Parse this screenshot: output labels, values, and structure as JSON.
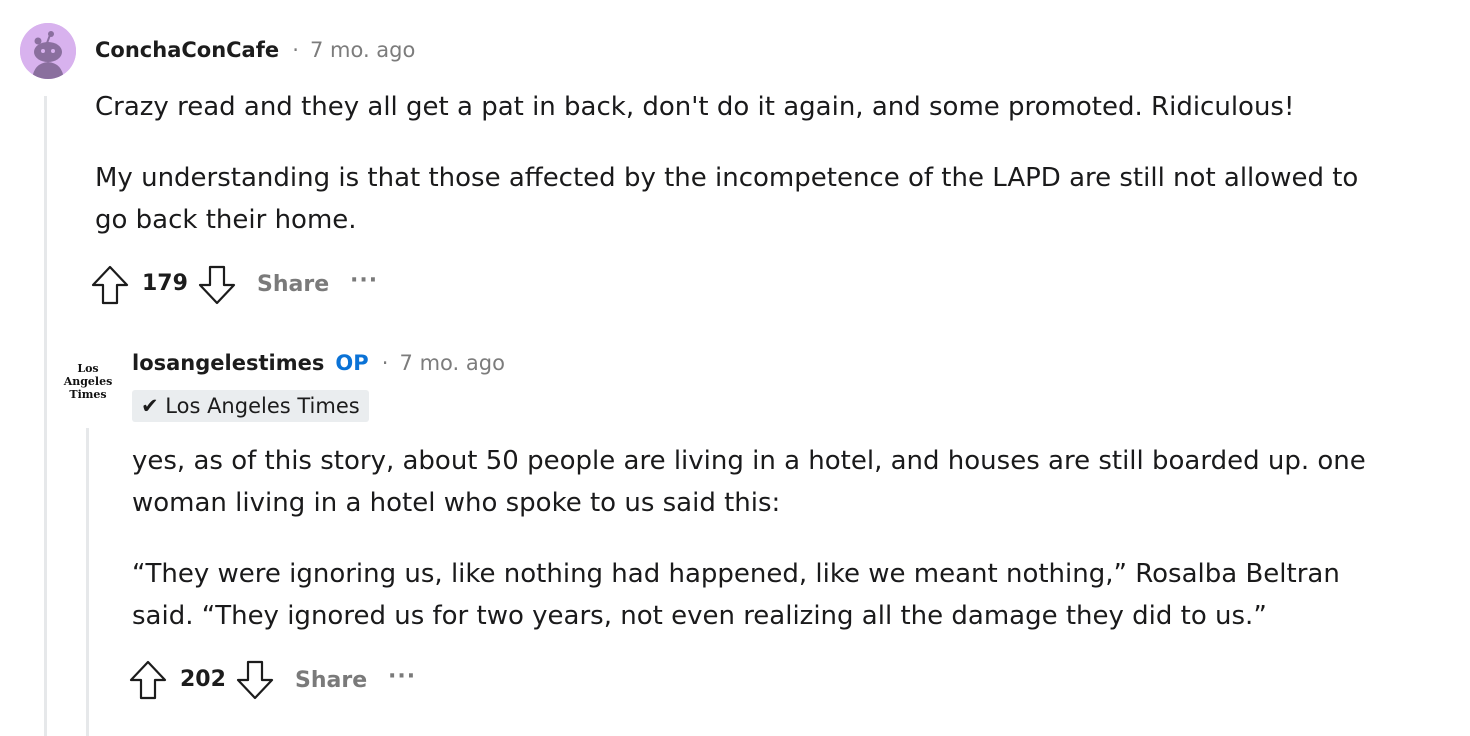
{
  "comments": [
    {
      "author": "ConchaConCafe",
      "separator": "·",
      "time": "7 mo. ago",
      "paragraphs": [
        "Crazy read and they all get a pat in back, don't do it again, and some promoted. Ridiculous!",
        "My understanding is that those affected by the incompetence of the LAPD are still not allowed to go back their home."
      ],
      "votes": "179",
      "share_label": "Share",
      "more_label": "···",
      "avatar_icon": "snoo-avatar-icon"
    },
    {
      "author": "losangelestimes",
      "op_label": "OP",
      "separator": "·",
      "time": "7 mo. ago",
      "flair": "✔ Los Angeles Times",
      "logo_lines": [
        "Los",
        "Angeles",
        "Times"
      ],
      "paragraphs": [
        "yes, as of this story, about 50 people are living in a hotel, and houses are still boarded up. one woman living in a hotel who spoke to us said this:",
        "“They were ignoring us, like nothing had happened, like we meant nothing,” Rosalba Beltran said. “They ignored us for two years, not even realizing all the damage they did to us.”"
      ],
      "votes": "202",
      "share_label": "Share",
      "more_label": "···"
    }
  ],
  "colors": {
    "avatar_bg": "#d8b2ee",
    "thread_line": "#e6e8ea",
    "op": "#0a72d6",
    "meta": "#7c7c7c"
  }
}
